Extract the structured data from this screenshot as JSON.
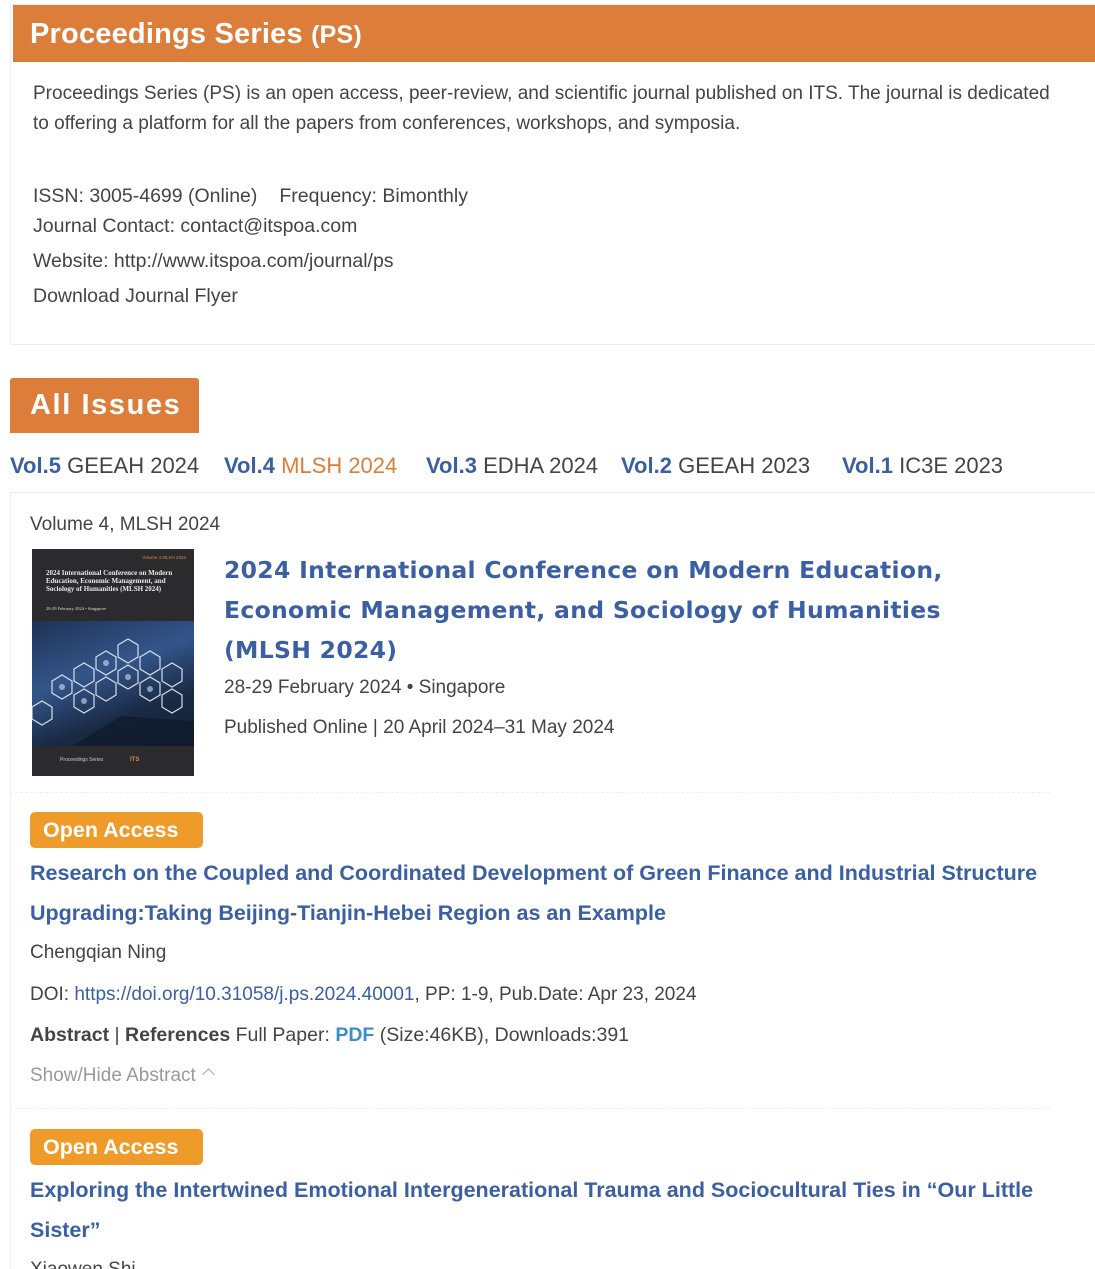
{
  "journal": {
    "title": "Proceedings Series",
    "abbr": "(PS)",
    "description": "Proceedings Series (PS) is an open access, peer-review, and scientific journal published on ITS. The journal is dedicated to offering a platform for all the papers from conferences, workshops, and symposia.",
    "issn": "ISSN: 3005-4699 (Online)",
    "frequency": "Frequency: Bimonthly",
    "contact": "Journal Contact: contact@itspoa.com",
    "website": "Website: http://www.itspoa.com/journal/ps",
    "flyer": "Download Journal Flyer"
  },
  "issues": {
    "tab_label": "All Issues",
    "volumes": [
      {
        "vol": "Vol.5",
        "name": "GEEAH 2024",
        "active": false
      },
      {
        "vol": "Vol.4",
        "name": "MLSH 2024",
        "active": true
      },
      {
        "vol": "Vol.3",
        "name": "EDHA 2024",
        "active": false
      },
      {
        "vol": "Vol.2",
        "name": "GEEAH 2023",
        "active": false
      },
      {
        "vol": "Vol.1",
        "name": "IC3E 2023",
        "active": false
      }
    ]
  },
  "volume": {
    "label": "Volume 4, MLSH 2024",
    "title": "2024 International Conference on Modern Education, Economic Management, and Sociology of Humanities (MLSH 2024)",
    "date_location": "28-29 February 2024 • Singapore",
    "published": "Published Online | 20 April 2024–31 May 2024",
    "cover": {
      "top_text": "Volume 4  MLSH 2024",
      "title": "2024 International Conference on Modern Education, Economic Management, and Sociology of Humanities (MLSH 2024)",
      "date": "28-29 February 2024 • Singapore",
      "logo_left": "Proceedings Series",
      "logo_right": "ITS"
    }
  },
  "articles": [
    {
      "badge": "Open Access",
      "title": "Research on the Coupled and Coordinated Development of Green Finance and Industrial Structure Upgrading:Taking Beijing-Tianjin-Hebei Region as an Example",
      "author": "Chengqian Ning",
      "doi_label": "DOI: ",
      "doi": "https://doi.org/10.31058/j.ps.2024.40001",
      "doi_rest": ", PP: 1-9, Pub.Date: Apr 23, 2024",
      "abstract_label": "Abstract",
      "divider": " | ",
      "references_label": "References",
      "full_paper": " Full Paper: ",
      "pdf": "PDF",
      "size_downloads": " (Size:46KB), Downloads:391",
      "toggle": "Show/Hide Abstract"
    },
    {
      "badge": "Open Access",
      "title": "Exploring the Intertwined Emotional Intergenerational Trauma and Sociocultural Ties in “Our Little Sister”",
      "author": "Xiaowen Shi"
    }
  ],
  "colors": {
    "accent_orange": "#dc7d3a",
    "badge_orange": "#ef9b2a",
    "link_blue": "#3a5fa3",
    "pdf_blue": "#3a8ec8"
  }
}
